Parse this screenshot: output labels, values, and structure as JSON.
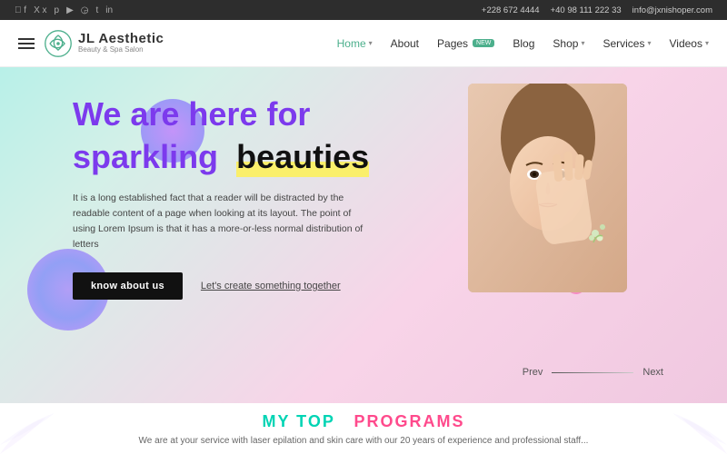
{
  "topbar": {
    "social_icons": [
      "facebook",
      "twitter",
      "pinterest",
      "youtube",
      "instagram",
      "tumblr",
      "linkedin"
    ],
    "phone1": "+228 672 4444",
    "phone2": "+40 98 111 222 33",
    "email": "info@jxnishoper.com"
  },
  "header": {
    "brand": "JL Aesthetic",
    "tagline": "Beauty & Spa Salon",
    "nav_items": [
      {
        "label": "Home",
        "active": true,
        "has_dropdown": true
      },
      {
        "label": "About",
        "has_dropdown": false
      },
      {
        "label": "Pages",
        "has_dropdown": false,
        "badge": "NEW"
      },
      {
        "label": "Blog",
        "has_dropdown": false
      },
      {
        "label": "Shop",
        "has_dropdown": true
      },
      {
        "label": "Services",
        "has_dropdown": true
      },
      {
        "label": "Videos",
        "has_dropdown": true
      }
    ]
  },
  "hero": {
    "title_line1": "We are here for",
    "title_line2_start": "sparkling",
    "title_line2_highlight": "beauties",
    "description": "It is a long established fact that a reader will be distracted by the readable content of a page when looking at its layout. The point of using Lorem Ipsum is that it has a more-or-less normal distribution of letters",
    "btn_primary": "know about us",
    "btn_link": "Let's create something together",
    "prev_label": "Prev",
    "next_label": "Next"
  },
  "bottom": {
    "title_part1": "MY TOP",
    "title_part2": "PROGRAMS",
    "description": "We are at your service with laser epilation and skin care with our 20 years of experience and professional staff..."
  }
}
